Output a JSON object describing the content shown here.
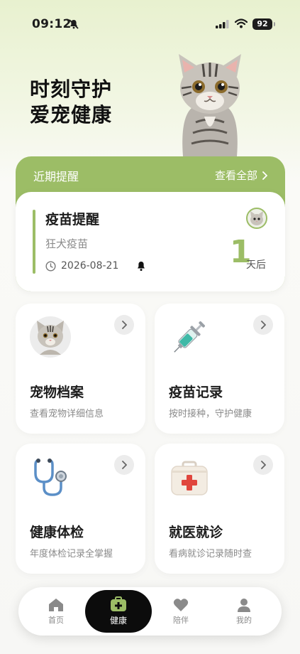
{
  "status_bar": {
    "time": "09:12",
    "battery": "92"
  },
  "hero": {
    "line1": "时刻守护",
    "line2": "爱宠健康"
  },
  "reminders": {
    "title": "近期提醒",
    "view_all": "查看全部",
    "card": {
      "title": "疫苗提醒",
      "subtitle": "狂犬疫苗",
      "date": "2026-08-21",
      "days": "1",
      "days_unit": "天后"
    }
  },
  "features": [
    {
      "title": "宠物档案",
      "desc": "查看宠物详细信息",
      "icon": "cat-avatar-icon"
    },
    {
      "title": "疫苗记录",
      "desc": "按时接种，守护健康",
      "icon": "syringe-icon"
    },
    {
      "title": "健康体检",
      "desc": "年度体检记录全掌握",
      "icon": "stethoscope-icon"
    },
    {
      "title": "就医就诊",
      "desc": "看病就诊记录随时查",
      "icon": "first-aid-kit-icon"
    }
  ],
  "tabs": [
    {
      "label": "首页",
      "icon": "home-icon"
    },
    {
      "label": "健康",
      "icon": "medical-case-icon",
      "active": true
    },
    {
      "label": "陪伴",
      "icon": "heart-icon"
    },
    {
      "label": "我的",
      "icon": "user-icon"
    }
  ],
  "colors": {
    "accent": "#9cbd66",
    "dark": "#0c0c0c",
    "muted": "#8a8a8a"
  }
}
